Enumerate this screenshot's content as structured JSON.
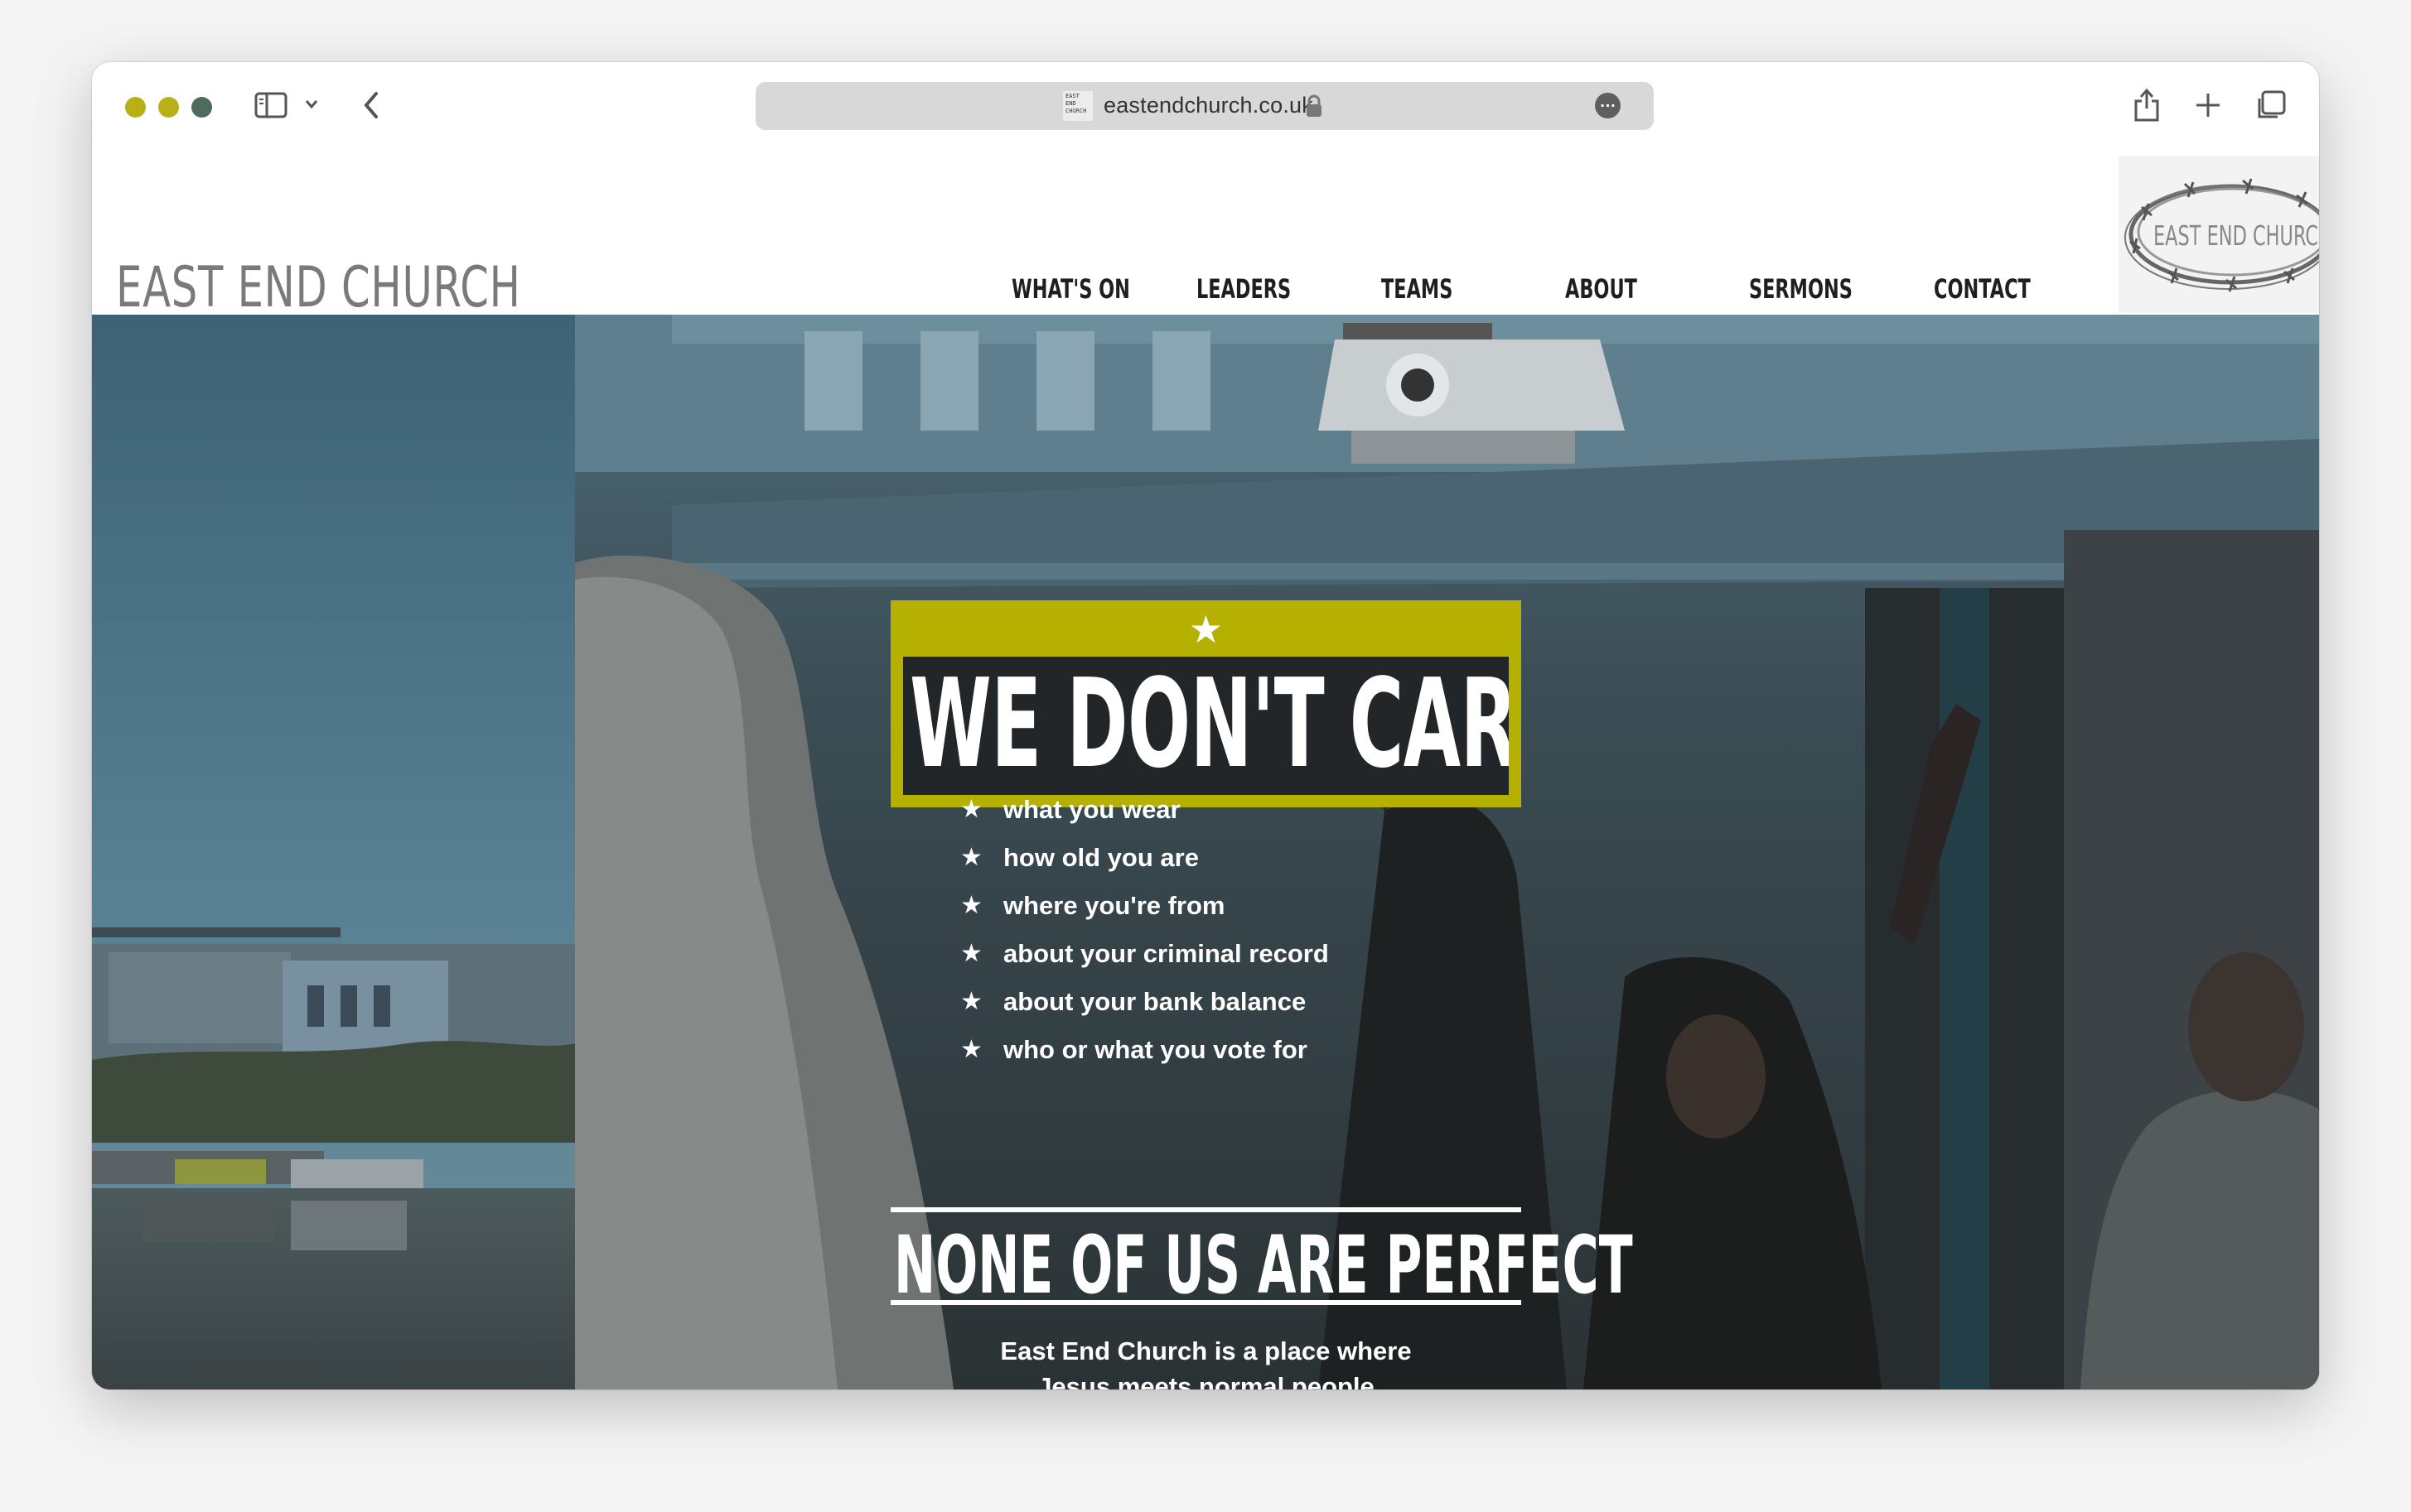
{
  "browser": {
    "url": "eastendchurch.co.uk",
    "favicon_text": [
      "EAST",
      "END",
      "CHURCH"
    ],
    "traffic_colors": [
      "#b7b016",
      "#b7b016",
      "#4e6b5c"
    ]
  },
  "site": {
    "logo": "EAST END CHURCH",
    "nav": [
      "WHAT'S ON",
      "LEADERS",
      "TEAMS",
      "ABOUT",
      "SERMONS",
      "CONTACT"
    ],
    "badge_logo": "EAST END CHURCH"
  },
  "hero": {
    "star": "★",
    "headline": "WE DON'T CARE",
    "list": [
      "what you wear",
      "how old you are",
      "where you're from",
      "about your criminal record",
      "about your bank balance",
      "who or what you vote for"
    ],
    "subheadline": "NONE OF US ARE PERFECT",
    "tagline_line1": "East End Church is a place where",
    "tagline_line2": "Jesus meets normal people",
    "accent_color": "#b6b000"
  }
}
